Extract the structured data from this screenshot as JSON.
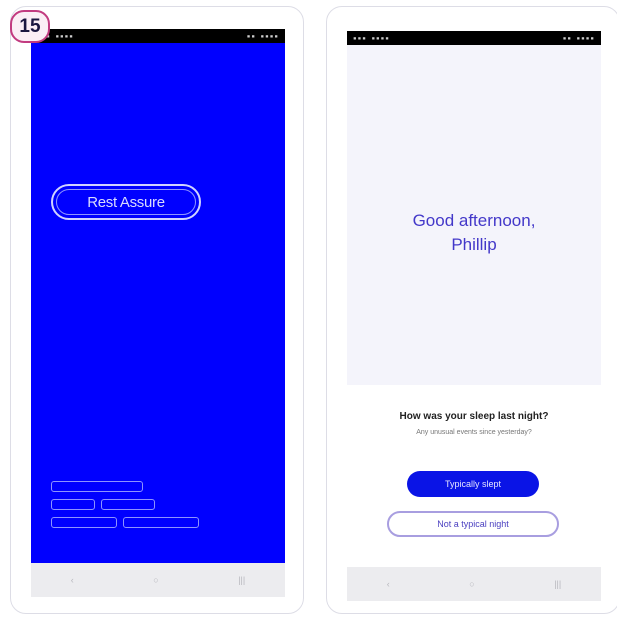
{
  "badge": {
    "number": "15"
  },
  "left_screen": {
    "status_left": "▪▪▪ ▪▪▪▪",
    "status_right": "▪▪ ▪▪▪▪",
    "logo": "Rest Assure",
    "chips": [
      "",
      "",
      "",
      "",
      ""
    ],
    "nav": {
      "back": "‹",
      "home": "○",
      "recents": "|||"
    }
  },
  "right_screen": {
    "status_left": "▪▪▪ ▪▪▪▪",
    "status_right": "▪▪ ▪▪▪▪",
    "greeting_line1": "Good afternoon,",
    "greeting_line2": "Phillip",
    "question": "How was your sleep last night?",
    "subtext": "Any unusual events since yesterday?",
    "primary_button": "Typically slept",
    "secondary_button": "Not a typical night",
    "nav": {
      "back": "‹",
      "home": "○",
      "recents": "|||"
    }
  }
}
